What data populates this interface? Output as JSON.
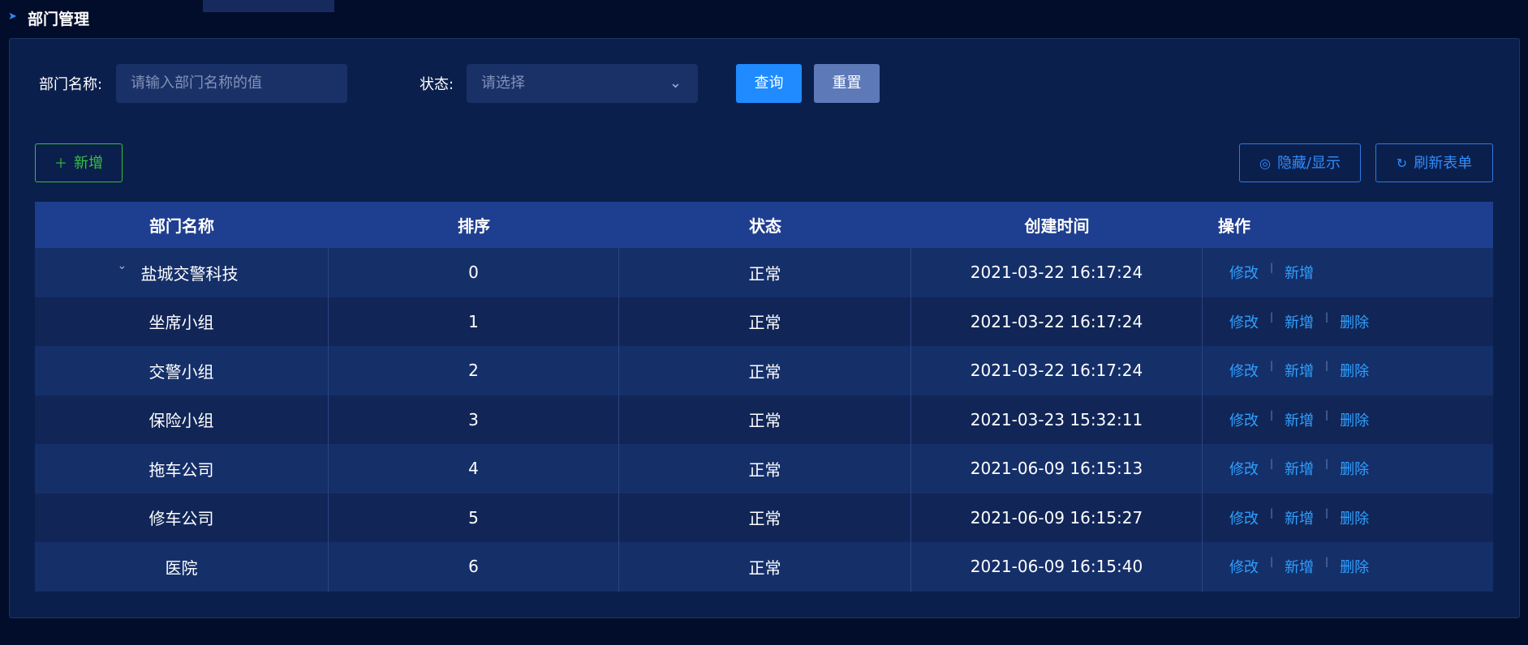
{
  "page": {
    "title": "部门管理"
  },
  "search": {
    "name_label": "部门名称:",
    "name_placeholder": "请输入部门名称的值",
    "status_label": "状态:",
    "status_placeholder": "请选择",
    "query_label": "查询",
    "reset_label": "重置"
  },
  "toolbar": {
    "add_label": "新增",
    "toggle_label": "隐藏/显示",
    "refresh_label": "刷新表单"
  },
  "table": {
    "columns": [
      "部门名称",
      "排序",
      "状态",
      "创建时间",
      "操作"
    ],
    "rows": [
      {
        "name": "盐城交警科技",
        "sort": "0",
        "status": "正常",
        "created": "2021-03-22 16:17:24",
        "actions": [
          "修改",
          "新增"
        ]
      },
      {
        "name": "坐席小组",
        "sort": "1",
        "status": "正常",
        "created": "2021-03-22 16:17:24",
        "actions": [
          "修改",
          "新增",
          "删除"
        ]
      },
      {
        "name": "交警小组",
        "sort": "2",
        "status": "正常",
        "created": "2021-03-22 16:17:24",
        "actions": [
          "修改",
          "新增",
          "删除"
        ]
      },
      {
        "name": "保险小组",
        "sort": "3",
        "status": "正常",
        "created": "2021-03-23 15:32:11",
        "actions": [
          "修改",
          "新增",
          "删除"
        ]
      },
      {
        "name": "拖车公司",
        "sort": "4",
        "status": "正常",
        "created": "2021-06-09 16:15:13",
        "actions": [
          "修改",
          "新增",
          "删除"
        ]
      },
      {
        "name": "修车公司",
        "sort": "5",
        "status": "正常",
        "created": "2021-06-09 16:15:27",
        "actions": [
          "修改",
          "新增",
          "删除"
        ]
      },
      {
        "name": "医院",
        "sort": "6",
        "status": "正常",
        "created": "2021-06-09 16:15:40",
        "actions": [
          "修改",
          "新增",
          "删除"
        ]
      }
    ]
  }
}
